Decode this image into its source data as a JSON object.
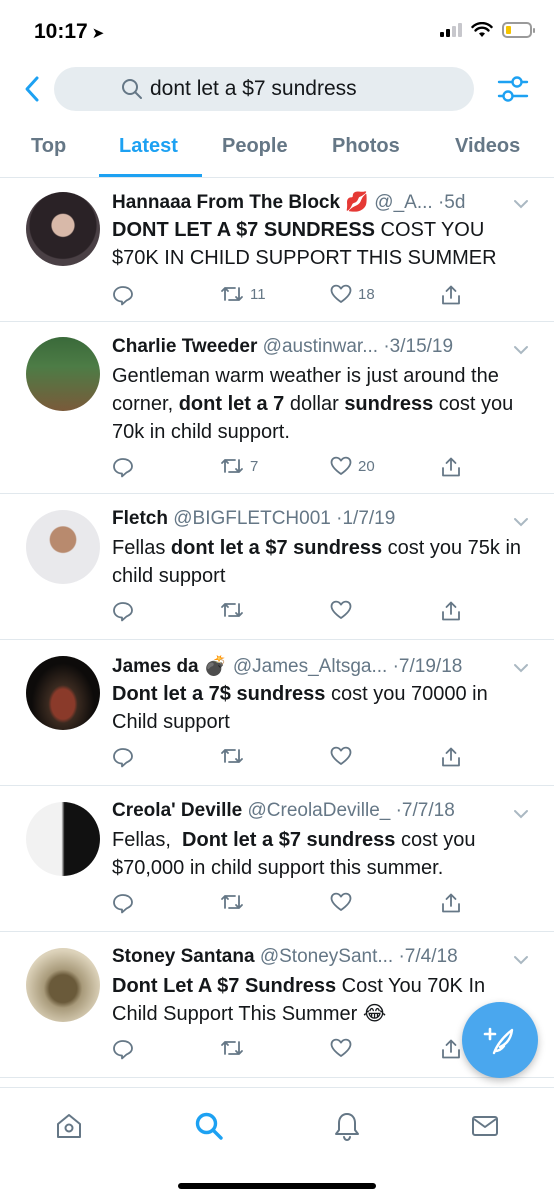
{
  "status_bar": {
    "time": "10:17",
    "location_arrow": "➤",
    "battery_level": 0.12,
    "battery_color": "#f5c400"
  },
  "search": {
    "query": "dont let a $7 sundress",
    "back_icon": "chevron-left-icon",
    "filter_icon": "sliders-icon"
  },
  "tabs": [
    {
      "label": "Top",
      "active": false
    },
    {
      "label": "Latest",
      "active": true
    },
    {
      "label": "People",
      "active": false
    },
    {
      "label": "Photos",
      "active": false
    },
    {
      "label": "Videos",
      "active": false
    }
  ],
  "tweets": [
    {
      "name": "Hannaaa From The Block",
      "name_emoji": "💋",
      "handle": "@_A...",
      "date": "·5d",
      "body_bold_1": "DONT LET A $7 SUNDRESS",
      "body_1": " COST YOU $70K IN CHILD SUPPORT THIS SUMMER",
      "retweets": "11",
      "likes": "18"
    },
    {
      "name": "Charlie Tweeder",
      "handle": "@austinwar...",
      "date": "·3/15/19",
      "body_1": "Gentleman warm weather is just around the corner, ",
      "body_bold_1": "dont let a 7",
      "body_2": " dollar ",
      "body_bold_2": "sundress",
      "body_3": " cost you 70k in child support.",
      "retweets": "7",
      "likes": "20"
    },
    {
      "name": "Fletch",
      "handle": "@BIGFLETCH001",
      "date": "·1/7/19",
      "body_1": "Fellas ",
      "body_bold_1": "dont let a $7 sundress",
      "body_2": " cost you 75k in child support",
      "retweets": "",
      "likes": ""
    },
    {
      "name": "James da",
      "name_emoji": "💣",
      "handle": "@James_Altsga...",
      "date": "·7/19/18",
      "body_bold_1": "Dont let a 7$ sundress",
      "body_1": " cost you 70000 in Child support",
      "retweets": "",
      "likes": ""
    },
    {
      "name": "Creola' Deville",
      "handle": "@CreolaDeville_",
      "date": "·7/7/18",
      "body_1": "Fellas,  ",
      "body_bold_1": "Dont let a $7 sundress",
      "body_2": " cost you $70,000 in child support this summer.",
      "retweets": "",
      "likes": ""
    },
    {
      "name": "Stoney Santana",
      "handle": "@StoneySant...",
      "date": "·7/4/18",
      "body_bold_1": "Dont Let A $7 Sundress",
      "body_1": " Cost You 70K In Child Support This Summer ",
      "body_emoji": "😂",
      "retweets": "",
      "likes": ""
    }
  ],
  "nav": {
    "items": [
      "home-icon",
      "search-icon",
      "notifications-icon",
      "messages-icon"
    ],
    "active": "search-icon"
  },
  "colors": {
    "accent": "#1da1f2",
    "secondary_text": "#657786",
    "divider": "#e1e8ed",
    "fab": "#4aa7ee"
  }
}
